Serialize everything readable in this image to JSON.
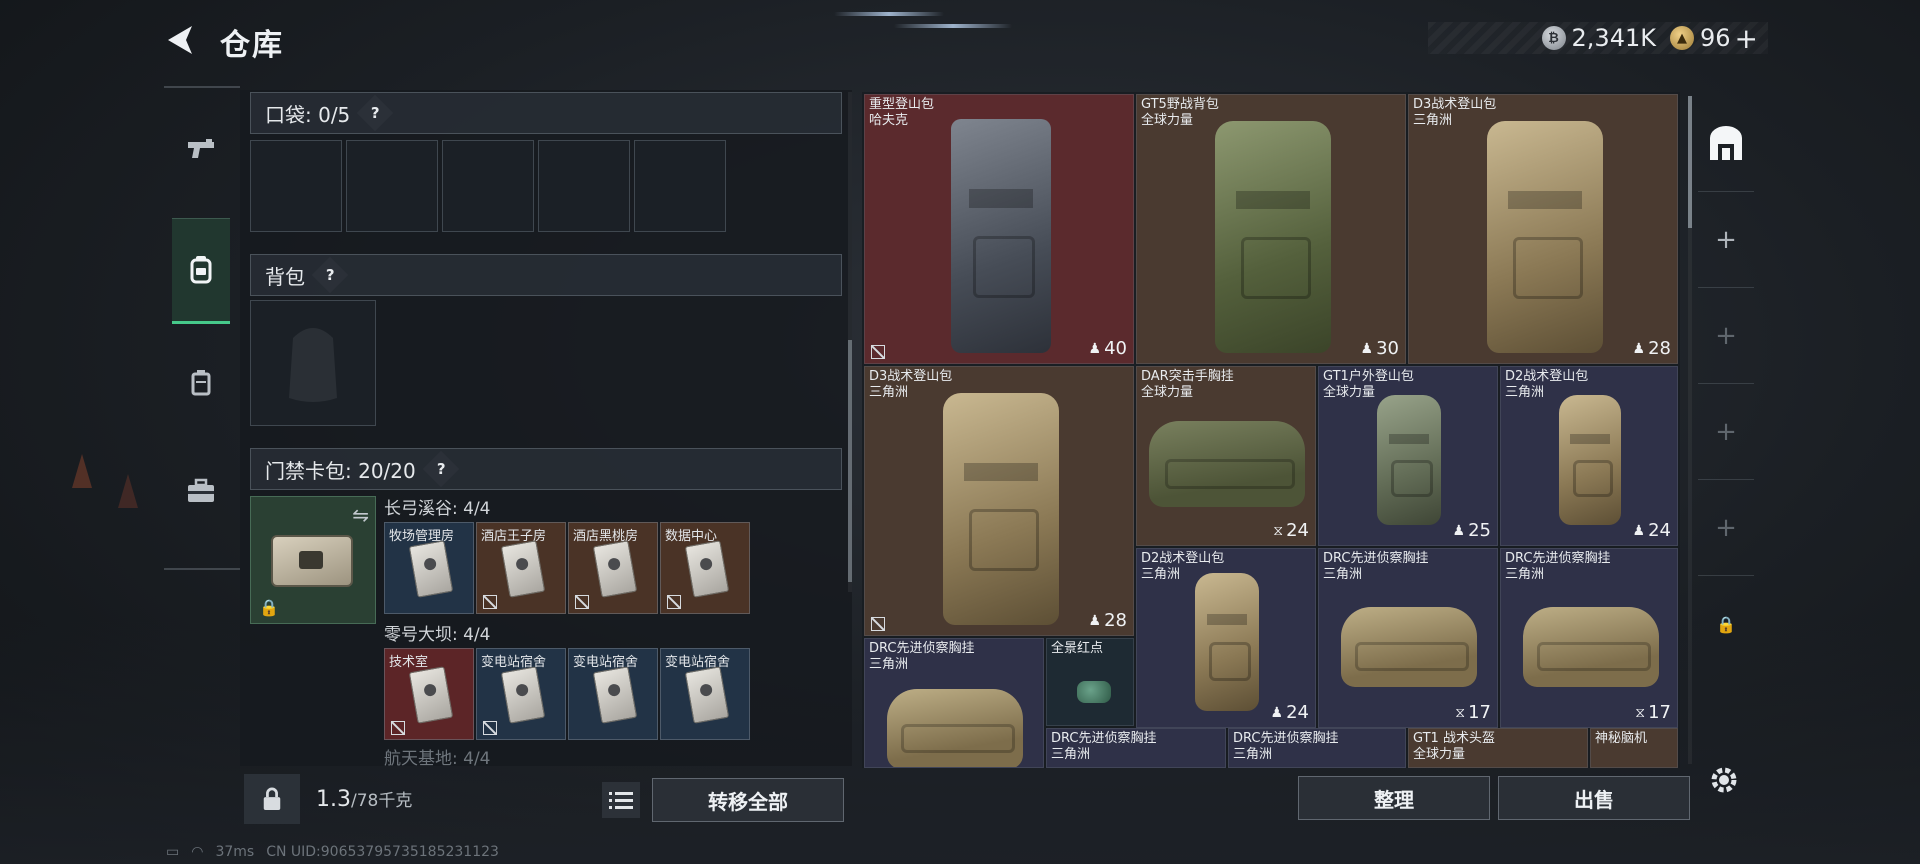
{
  "header": {
    "title": "仓库",
    "currency_silver": "2,341K",
    "currency_gold": "96",
    "gold_plus": "+"
  },
  "side_nav": {
    "items": [
      {
        "name": "weapons",
        "icon": "pistol-icon"
      },
      {
        "name": "gear",
        "icon": "backpack-gear-icon",
        "active": true
      },
      {
        "name": "consumables",
        "icon": "canister-icon"
      },
      {
        "name": "cases",
        "icon": "briefcase-icon"
      }
    ]
  },
  "pocket": {
    "label": "口袋: 0/5",
    "help": "?",
    "slot_count": 5
  },
  "backpack": {
    "label": "背包",
    "help": "?"
  },
  "keycase": {
    "label": "门禁卡包: 20/20",
    "help": "?",
    "areas": [
      {
        "label": "长弓溪谷: 4/4",
        "cards": [
          {
            "name": "牧场管理房",
            "rarity": "blue"
          },
          {
            "name": "酒店王子房",
            "rarity": "brown"
          },
          {
            "name": "酒店黑桃房",
            "rarity": "brown"
          },
          {
            "name": "数据中心",
            "rarity": "brown"
          }
        ]
      },
      {
        "label": "零号大坝: 4/4",
        "cards": [
          {
            "name": "技术室",
            "rarity": "red"
          },
          {
            "name": "变电站宿舍",
            "rarity": "blue"
          },
          {
            "name": "变电站宿舍",
            "rarity": "blue"
          },
          {
            "name": "变电站宿舍",
            "rarity": "blue"
          }
        ]
      },
      {
        "label": "航天基地: 4/4"
      }
    ]
  },
  "footer_left": {
    "weight_value": "1.3",
    "weight_max": "/78千克",
    "transfer_all": "转移全部"
  },
  "storage": {
    "items": [
      {
        "name": "重型登山包",
        "brand": "哈夫克",
        "stat": "40",
        "stat_icon": "capacity-icon",
        "rarity": "red",
        "no_insure": true
      },
      {
        "name": "GT5野战背包",
        "brand": "全球力量",
        "stat": "30",
        "stat_icon": "capacity-icon",
        "rarity": "brown"
      },
      {
        "name": "D3战术登山包",
        "brand": "三角洲",
        "stat": "28",
        "stat_icon": "capacity-icon",
        "rarity": "brown"
      },
      {
        "name": "D3战术登山包",
        "brand": "三角洲",
        "stat": "28",
        "stat_icon": "capacity-icon",
        "rarity": "brown",
        "no_insure": true
      },
      {
        "name": "DAR突击手胸挂",
        "brand": "全球力量",
        "stat": "24",
        "stat_icon": "vest-icon",
        "rarity": "brown"
      },
      {
        "name": "GT1户外登山包",
        "brand": "全球力量",
        "stat": "25",
        "stat_icon": "capacity-icon",
        "rarity": "blue"
      },
      {
        "name": "D2战术登山包",
        "brand": "三角洲",
        "stat": "24",
        "stat_icon": "capacity-icon",
        "rarity": "blue"
      },
      {
        "name": "D2战术登山包",
        "brand": "三角洲",
        "stat": "24",
        "stat_icon": "capacity-icon",
        "rarity": "blue"
      },
      {
        "name": "DRC先进侦察胸挂",
        "brand": "三角洲",
        "stat": "17",
        "stat_icon": "vest-icon",
        "rarity": "blue"
      },
      {
        "name": "DRC先进侦察胸挂",
        "brand": "三角洲",
        "stat": "17",
        "stat_icon": "vest-icon",
        "rarity": "blue"
      },
      {
        "name": "DRC先进侦察胸挂",
        "brand": "三角洲",
        "rarity": "blue"
      },
      {
        "name": "全景红点",
        "brand": "",
        "rarity": "dark"
      },
      {
        "name": "DRC先进侦察胸挂",
        "brand": "三角洲",
        "rarity": "blue"
      },
      {
        "name": "DRC先进侦察胸挂",
        "brand": "三角洲",
        "rarity": "blue"
      },
      {
        "name": "GT1 战术头盔",
        "brand": "全球力量",
        "rarity": "brown"
      },
      {
        "name": "神秘脑机",
        "brand": "",
        "rarity": "brown"
      }
    ],
    "sort_label": "整理",
    "sell_label": "出售"
  },
  "right_col": {
    "items": [
      "safe-box-icon",
      "plus-icon",
      "plus-icon",
      "plus-icon",
      "plus-icon",
      "lock-icon"
    ]
  },
  "status_bar": {
    "ping": "37ms",
    "uid": "CN UID:9065379573518523112​3"
  }
}
